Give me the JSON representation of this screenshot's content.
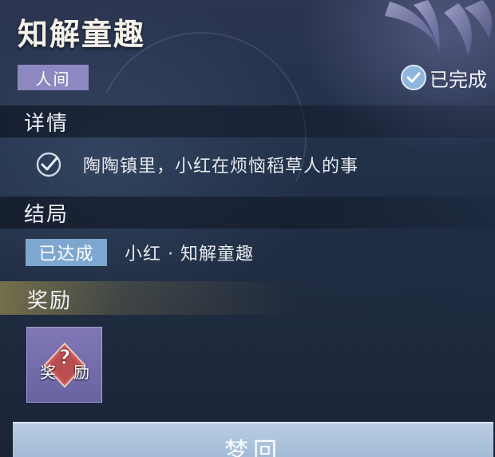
{
  "quest": {
    "title": "知解童趣",
    "realm_tag": "人间",
    "status": "已完成"
  },
  "details": {
    "heading": "详情",
    "items": [
      {
        "text": "陶陶镇里，小红在烦恼稻草人的事"
      }
    ]
  },
  "ending": {
    "heading": "结局",
    "badge": "已达成",
    "text": "小红 · 知解童趣"
  },
  "reward": {
    "heading": "奖励",
    "item_label_left": "奖",
    "item_label_right": "励",
    "item_icon": "question-mark-gem-icon"
  },
  "action": {
    "label": "梦回"
  },
  "colors": {
    "realm_tag_bg": "#8d88c0",
    "ending_badge_bg": "#7ea7cf",
    "reward_slot_bg": "#7f77b6",
    "reward_gem": "#c85a5e",
    "button_bg": "#b9cde3"
  }
}
